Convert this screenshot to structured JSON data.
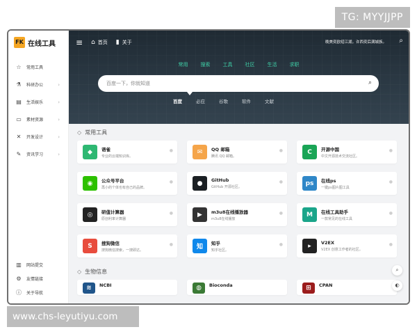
{
  "watermark": {
    "top": "TG: MYYJJPP",
    "bottom": "www.chs-leyutiyu.com"
  },
  "brand": {
    "mark": "FK",
    "name": "在线工具"
  },
  "sidebar": {
    "items": [
      {
        "label": "常用工具",
        "icon": "star-icon",
        "glyph": "☆",
        "chevron": ""
      },
      {
        "label": "科研办公",
        "icon": "flask-icon",
        "glyph": "⚗",
        "chevron": "›"
      },
      {
        "label": "生活娱乐",
        "icon": "film-icon",
        "glyph": "▤",
        "chevron": "›"
      },
      {
        "label": "素材资源",
        "icon": "folder-icon",
        "glyph": "▭",
        "chevron": "›"
      },
      {
        "label": "开发设计",
        "icon": "tools-icon",
        "glyph": "✕",
        "chevron": "›"
      },
      {
        "label": "资讯学习",
        "icon": "pencil-icon",
        "glyph": "✎",
        "chevron": "›"
      }
    ],
    "bottom": [
      {
        "label": "网站提交",
        "icon": "upload-icon",
        "glyph": "▥"
      },
      {
        "label": "友情链接",
        "icon": "gear-icon",
        "glyph": "⚙"
      },
      {
        "label": "关于导航",
        "icon": "info-icon",
        "glyph": "ⓘ"
      }
    ]
  },
  "topbar": {
    "menu_icon": "≡",
    "home": "首页",
    "about": "关于",
    "greeting": "晚美奕欧绍江湖，许西奕后满城族。"
  },
  "hero": {
    "categories": [
      "常用",
      "搜索",
      "工具",
      "社区",
      "生活",
      "求职"
    ],
    "search_placeholder": "百度一下，你就知道",
    "engines": [
      "百度",
      "必应",
      "谷歌",
      "软件",
      "文献"
    ],
    "active_engine": "百度"
  },
  "sections": [
    {
      "title": "常用工具",
      "cards": [
        {
          "name": "语雀",
          "desc": "专业的云端知识库。",
          "color": "#2eb872",
          "glyph": "◆"
        },
        {
          "name": "QQ 邮箱",
          "desc": "腾讯 QQ 邮箱。",
          "color": "#f5a54a",
          "glyph": "✉"
        },
        {
          "name": "开源中国",
          "desc": "中文开源技术交流社区。",
          "color": "#1aa556",
          "glyph": "C"
        },
        {
          "name": "公众号平台",
          "desc": "再小的个体也有自己的品牌。",
          "color": "#2dc100",
          "glyph": "◉"
        },
        {
          "name": "GitHub",
          "desc": "GitHub 开源社区。",
          "color": "#1b1f23",
          "glyph": "●"
        },
        {
          "name": "在线ps",
          "desc": "一键ps图片图工具",
          "color": "#2f87c8",
          "glyph": "ps"
        },
        {
          "name": "研值计算器",
          "desc": "原创利率计算器",
          "color": "#222222",
          "glyph": "◎"
        },
        {
          "name": "m3u8在线播放器",
          "desc": "m3u8在线播放",
          "color": "#333333",
          "glyph": "▶"
        },
        {
          "name": "在线工具助手",
          "desc": "一款常见的在线工具",
          "color": "#1aa58a",
          "glyph": "M"
        },
        {
          "name": "搜狗微信",
          "desc": "搜狗微信搜索，一搜即达。",
          "color": "#e84c3d",
          "glyph": "S"
        },
        {
          "name": "知乎",
          "desc": "知乎社区。",
          "color": "#0f88eb",
          "glyph": "知"
        },
        {
          "name": "V2EX",
          "desc": "V2EX 创意工作者的社区。",
          "color": "#222222",
          "glyph": "▸"
        }
      ]
    },
    {
      "title": "生物信息",
      "cards": [
        {
          "name": "NCBI",
          "desc": "",
          "color": "#20558a",
          "glyph": "≋"
        },
        {
          "name": "Bioconda",
          "desc": "",
          "color": "#3b7a35",
          "glyph": "◍"
        },
        {
          "name": "CPAN",
          "desc": "",
          "color": "#9b1c1c",
          "glyph": "⊞"
        }
      ]
    }
  ],
  "float_buttons": [
    {
      "name": "search",
      "glyph": "⌕"
    },
    {
      "name": "theme",
      "glyph": "◐"
    }
  ]
}
